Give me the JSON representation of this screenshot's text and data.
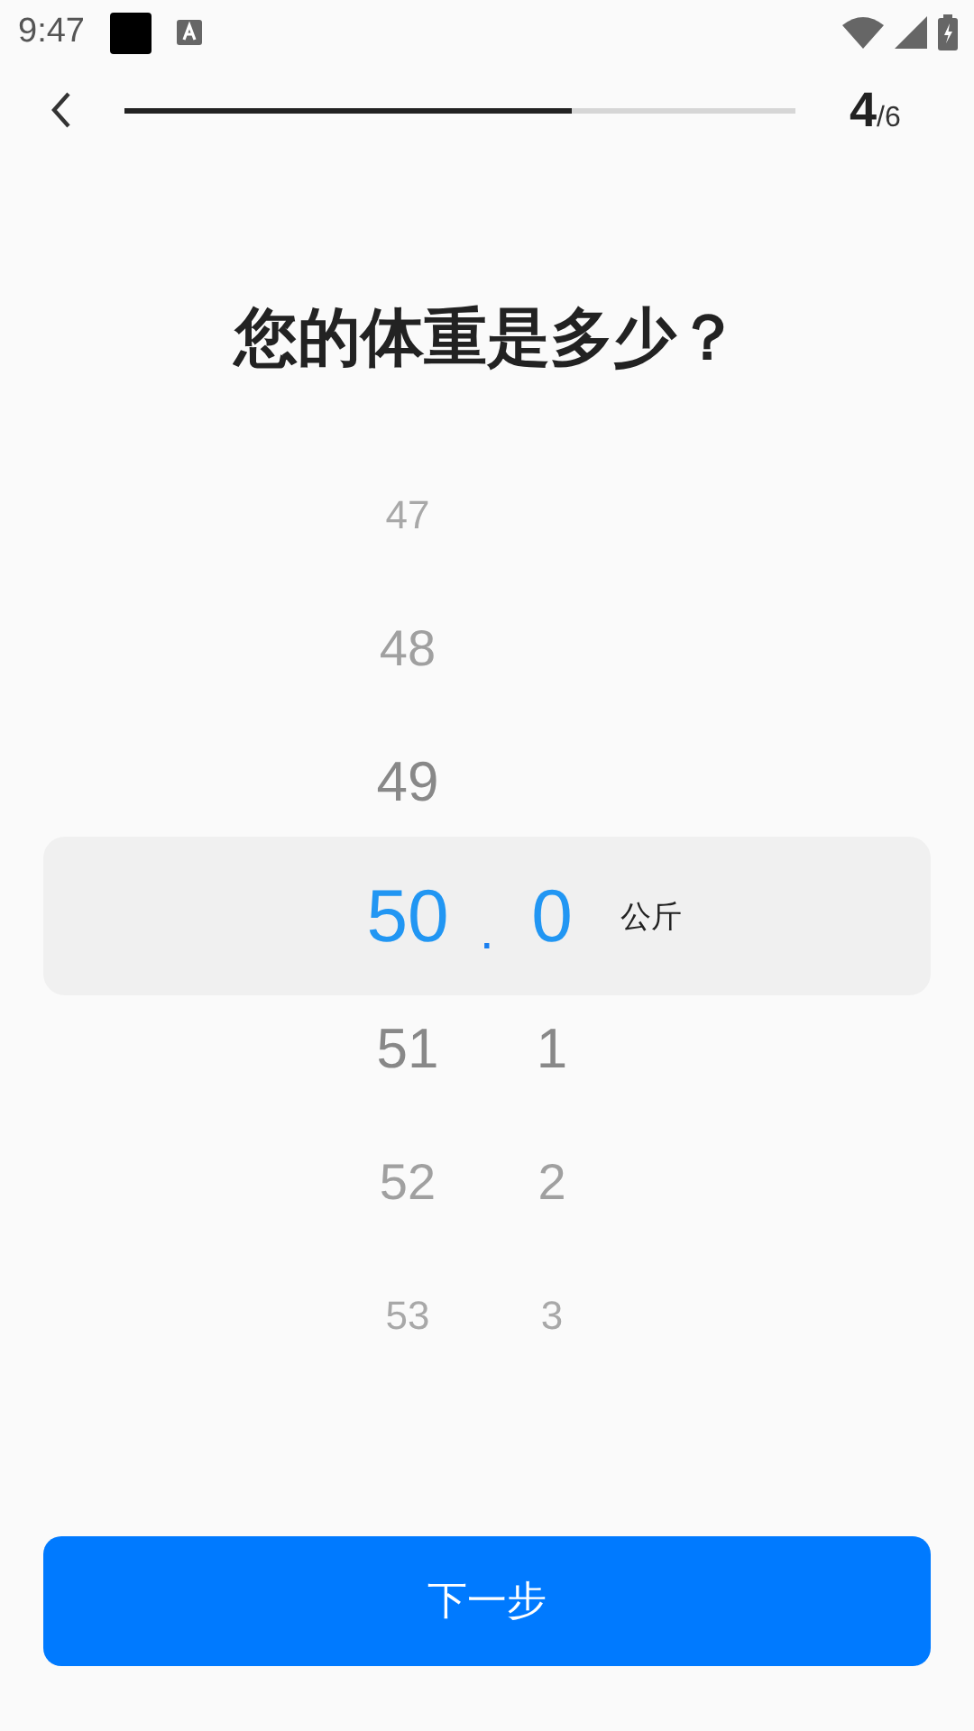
{
  "status_bar": {
    "time": "9:47"
  },
  "header": {
    "progress": {
      "level": 0.667
    },
    "step": "4",
    "total": "/6"
  },
  "title": "您的体重是多少？",
  "picker": {
    "separator": ".",
    "unit": "公斤",
    "rows": [
      {
        "integer": "47",
        "selected": false
      },
      {
        "integer": "48",
        "selected": false
      },
      {
        "integer": "49",
        "selected": false
      },
      {
        "integer": "50",
        "decimal": "0",
        "selected": true
      },
      {
        "integer": "51",
        "decimal": "1",
        "selected": false
      },
      {
        "integer": "52",
        "decimal": "2",
        "selected": false
      },
      {
        "integer": "53",
        "decimal": "3",
        "selected": false
      }
    ]
  },
  "next_button": "下一步"
}
